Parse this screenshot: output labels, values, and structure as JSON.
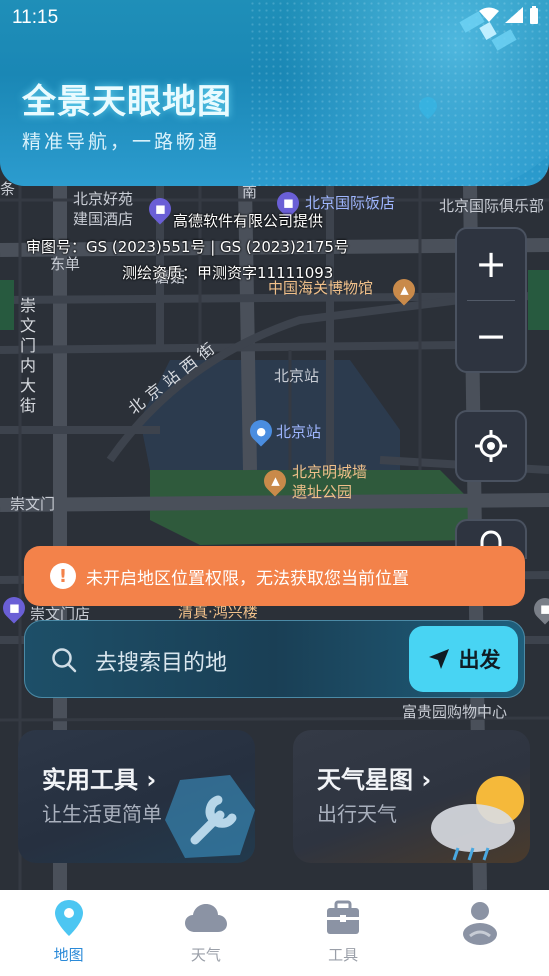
{
  "status_bar": {
    "time": "11:15"
  },
  "header": {
    "title": "全景天眼地图",
    "subtitle": "精准导航，一路畅通"
  },
  "map": {
    "credits": [
      "高德软件有限公司提供",
      "审图号：GS (2023)551号 | GS (2023)2175号",
      "测绘资质：甲测资字11111093"
    ],
    "pois": [
      "北京好苑",
      "建国酒店",
      "北京国际饭店",
      "北京国际俱乐部",
      "中国海关博物馆",
      "北京站",
      "北京站",
      "北京明城墙",
      "遗址公园",
      "崇文门",
      "东单",
      "南",
      "条",
      "蘑菇",
      "清真·鸿兴楼",
      "崇文门店",
      "富贵园购物中心"
    ],
    "roads": [
      "北京站西街",
      "崇文门内大街"
    ]
  },
  "map_controls": {
    "zoom_in": "+",
    "zoom_out": "−"
  },
  "warning": {
    "text": "未开启地区位置权限，无法获取您当前位置"
  },
  "search": {
    "placeholder": "去搜索目的地",
    "go_label": "出发"
  },
  "cards": [
    {
      "title": "实用工具",
      "subtitle": "让生活更简单"
    },
    {
      "title": "天气星图",
      "subtitle": "出行天气"
    }
  ],
  "tabs": [
    {
      "label": "地图",
      "active": true
    },
    {
      "label": "天气",
      "active": false
    },
    {
      "label": "工具",
      "active": false
    },
    {
      "label": "",
      "active": false
    }
  ],
  "colors": {
    "accent": "#48d4f3",
    "tab_active": "#2b8ad8",
    "warning": "#f3824a"
  }
}
